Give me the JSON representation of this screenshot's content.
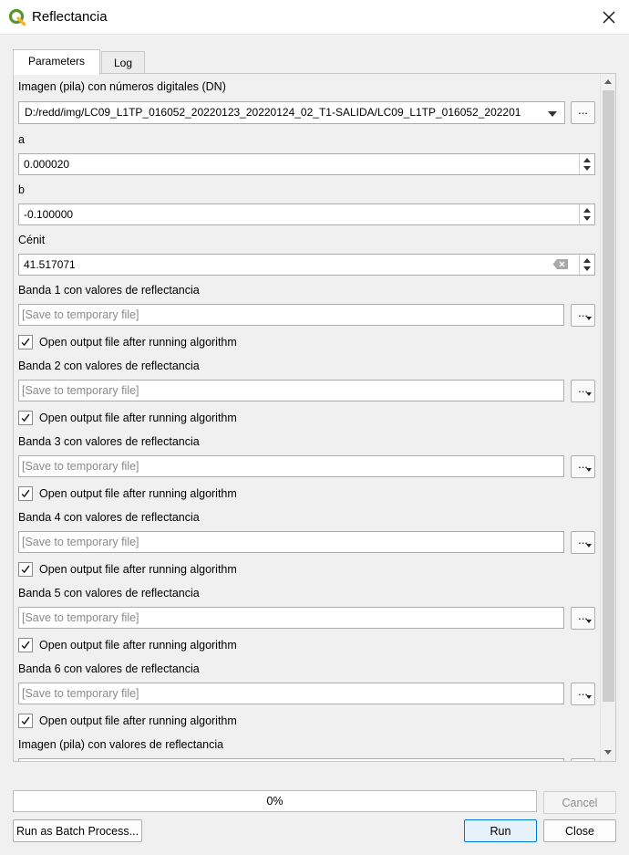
{
  "window": {
    "title": "Reflectancia",
    "accent": "#589632"
  },
  "tabs": [
    {
      "label": "Parameters"
    },
    {
      "label": "Log"
    }
  ],
  "params": {
    "input_label": "Imagen (pila) con números digitales (DN)",
    "input_value": "D:/redd/img/LC09_L1TP_016052_20220123_20220124_02_T1-SALIDA/LC09_L1TP_016052_202201",
    "a_label": "a",
    "a_value": "0.000020",
    "b_label": "b",
    "b_value": "-0.100000",
    "zenith_label": "Cénit",
    "zenith_value": "41.517071",
    "dots": "...",
    "bands": [
      {
        "label": "Banda 1 con valores de reflectancia",
        "placeholder": "[Save to temporary file]",
        "open_label": "Open output file after running algorithm",
        "checked": true
      },
      {
        "label": "Banda 2 con valores de reflectancia",
        "placeholder": "[Save to temporary file]",
        "open_label": "Open output file after running algorithm",
        "checked": true
      },
      {
        "label": "Banda 3 con valores de reflectancia",
        "placeholder": "[Save to temporary file]",
        "open_label": "Open output file after running algorithm",
        "checked": true
      },
      {
        "label": "Banda 4 con valores de reflectancia",
        "placeholder": "[Save to temporary file]",
        "open_label": "Open output file after running algorithm",
        "checked": true
      },
      {
        "label": "Banda 5 con valores de reflectancia",
        "placeholder": "[Save to temporary file]",
        "open_label": "Open output file after running algorithm",
        "checked": true
      },
      {
        "label": "Banda 6 con valores de reflectancia",
        "placeholder": "[Save to temporary file]",
        "open_label": "Open output file after running algorithm",
        "checked": true
      }
    ],
    "stack_label": "Imagen (pila) con valores de reflectancia"
  },
  "footer": {
    "progress_text": "0%",
    "progress_value": 0,
    "cancel_label": "Cancel",
    "batch_label": "Run as Batch Process...",
    "run_label": "Run",
    "close_label": "Close"
  }
}
